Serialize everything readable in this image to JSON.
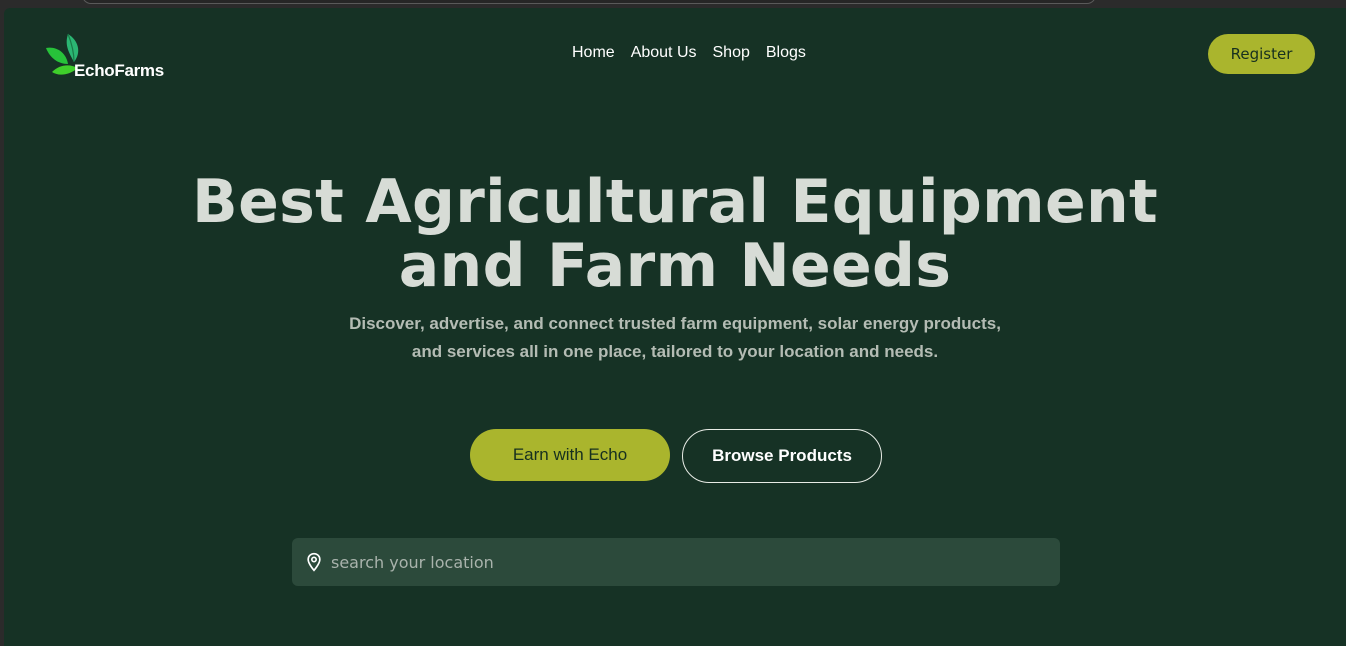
{
  "brand": {
    "name": "EchoFarms"
  },
  "nav": {
    "items": [
      {
        "label": "Home"
      },
      {
        "label": "About Us"
      },
      {
        "label": "Shop"
      },
      {
        "label": "Blogs"
      }
    ]
  },
  "header": {
    "register_label": "Register"
  },
  "hero": {
    "title_line1": "Best Agricultural Equipment",
    "title_line2": "and Farm Needs",
    "subtitle_line1": "Discover, advertise, and connect trusted farm equipment, solar energy products,",
    "subtitle_line2": "and services all in one place, tailored to your location and needs.",
    "earn_label": "Earn with Echo",
    "browse_label": "Browse Products"
  },
  "search": {
    "placeholder": "search your location",
    "value": "",
    "icon": "location-pin-icon"
  },
  "colors": {
    "background": "#163225",
    "accent": "#aab52d",
    "search_bg": "#2c4a3b",
    "title": "#d7dcd6"
  }
}
